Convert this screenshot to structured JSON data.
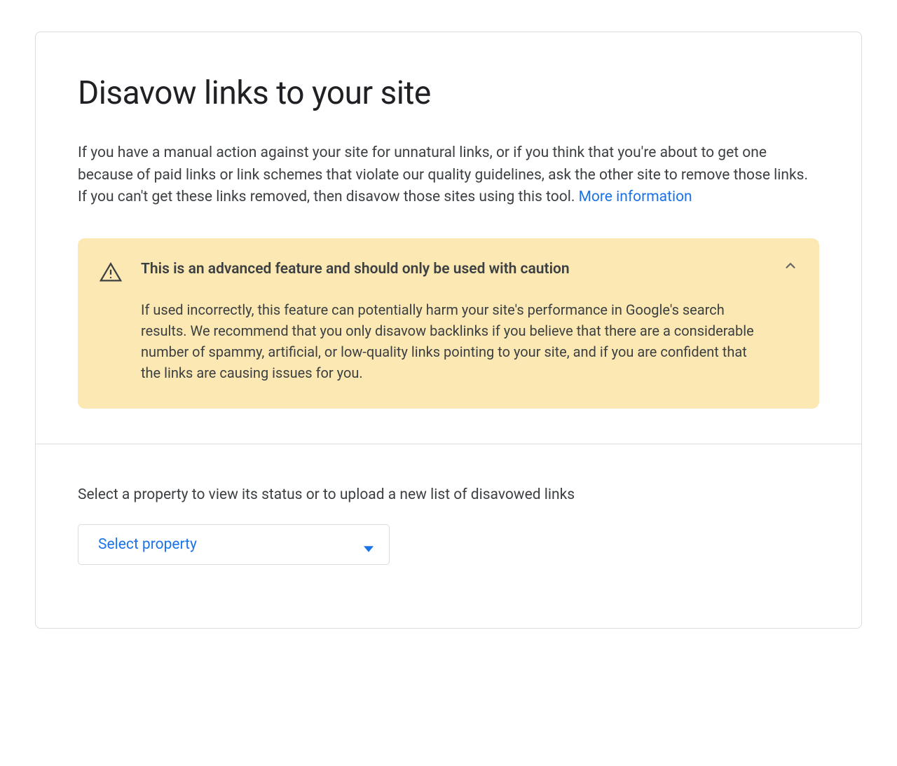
{
  "title": "Disavow links to your site",
  "description_text": "If you have a manual action against your site for unnatural links, or if you think that you're about to get one because of paid links or link schemes that violate our quality guidelines, ask the other site to remove those links. If you can't get these links removed, then disavow those sites using this tool. ",
  "description_link": "More information",
  "warning": {
    "title": "This is an advanced feature and should only be used with caution",
    "body": "If used incorrectly, this feature can potentially harm your site's performance in Google's search results. We recommend that you only disavow backlinks if you believe that there are a considerable number of spammy, artificial, or low-quality links pointing to your site, and if you are confident that the links are causing issues for you."
  },
  "select_section": {
    "label": "Select a property to view its status or to upload a new list of disavowed links",
    "button_label": "Select property"
  }
}
